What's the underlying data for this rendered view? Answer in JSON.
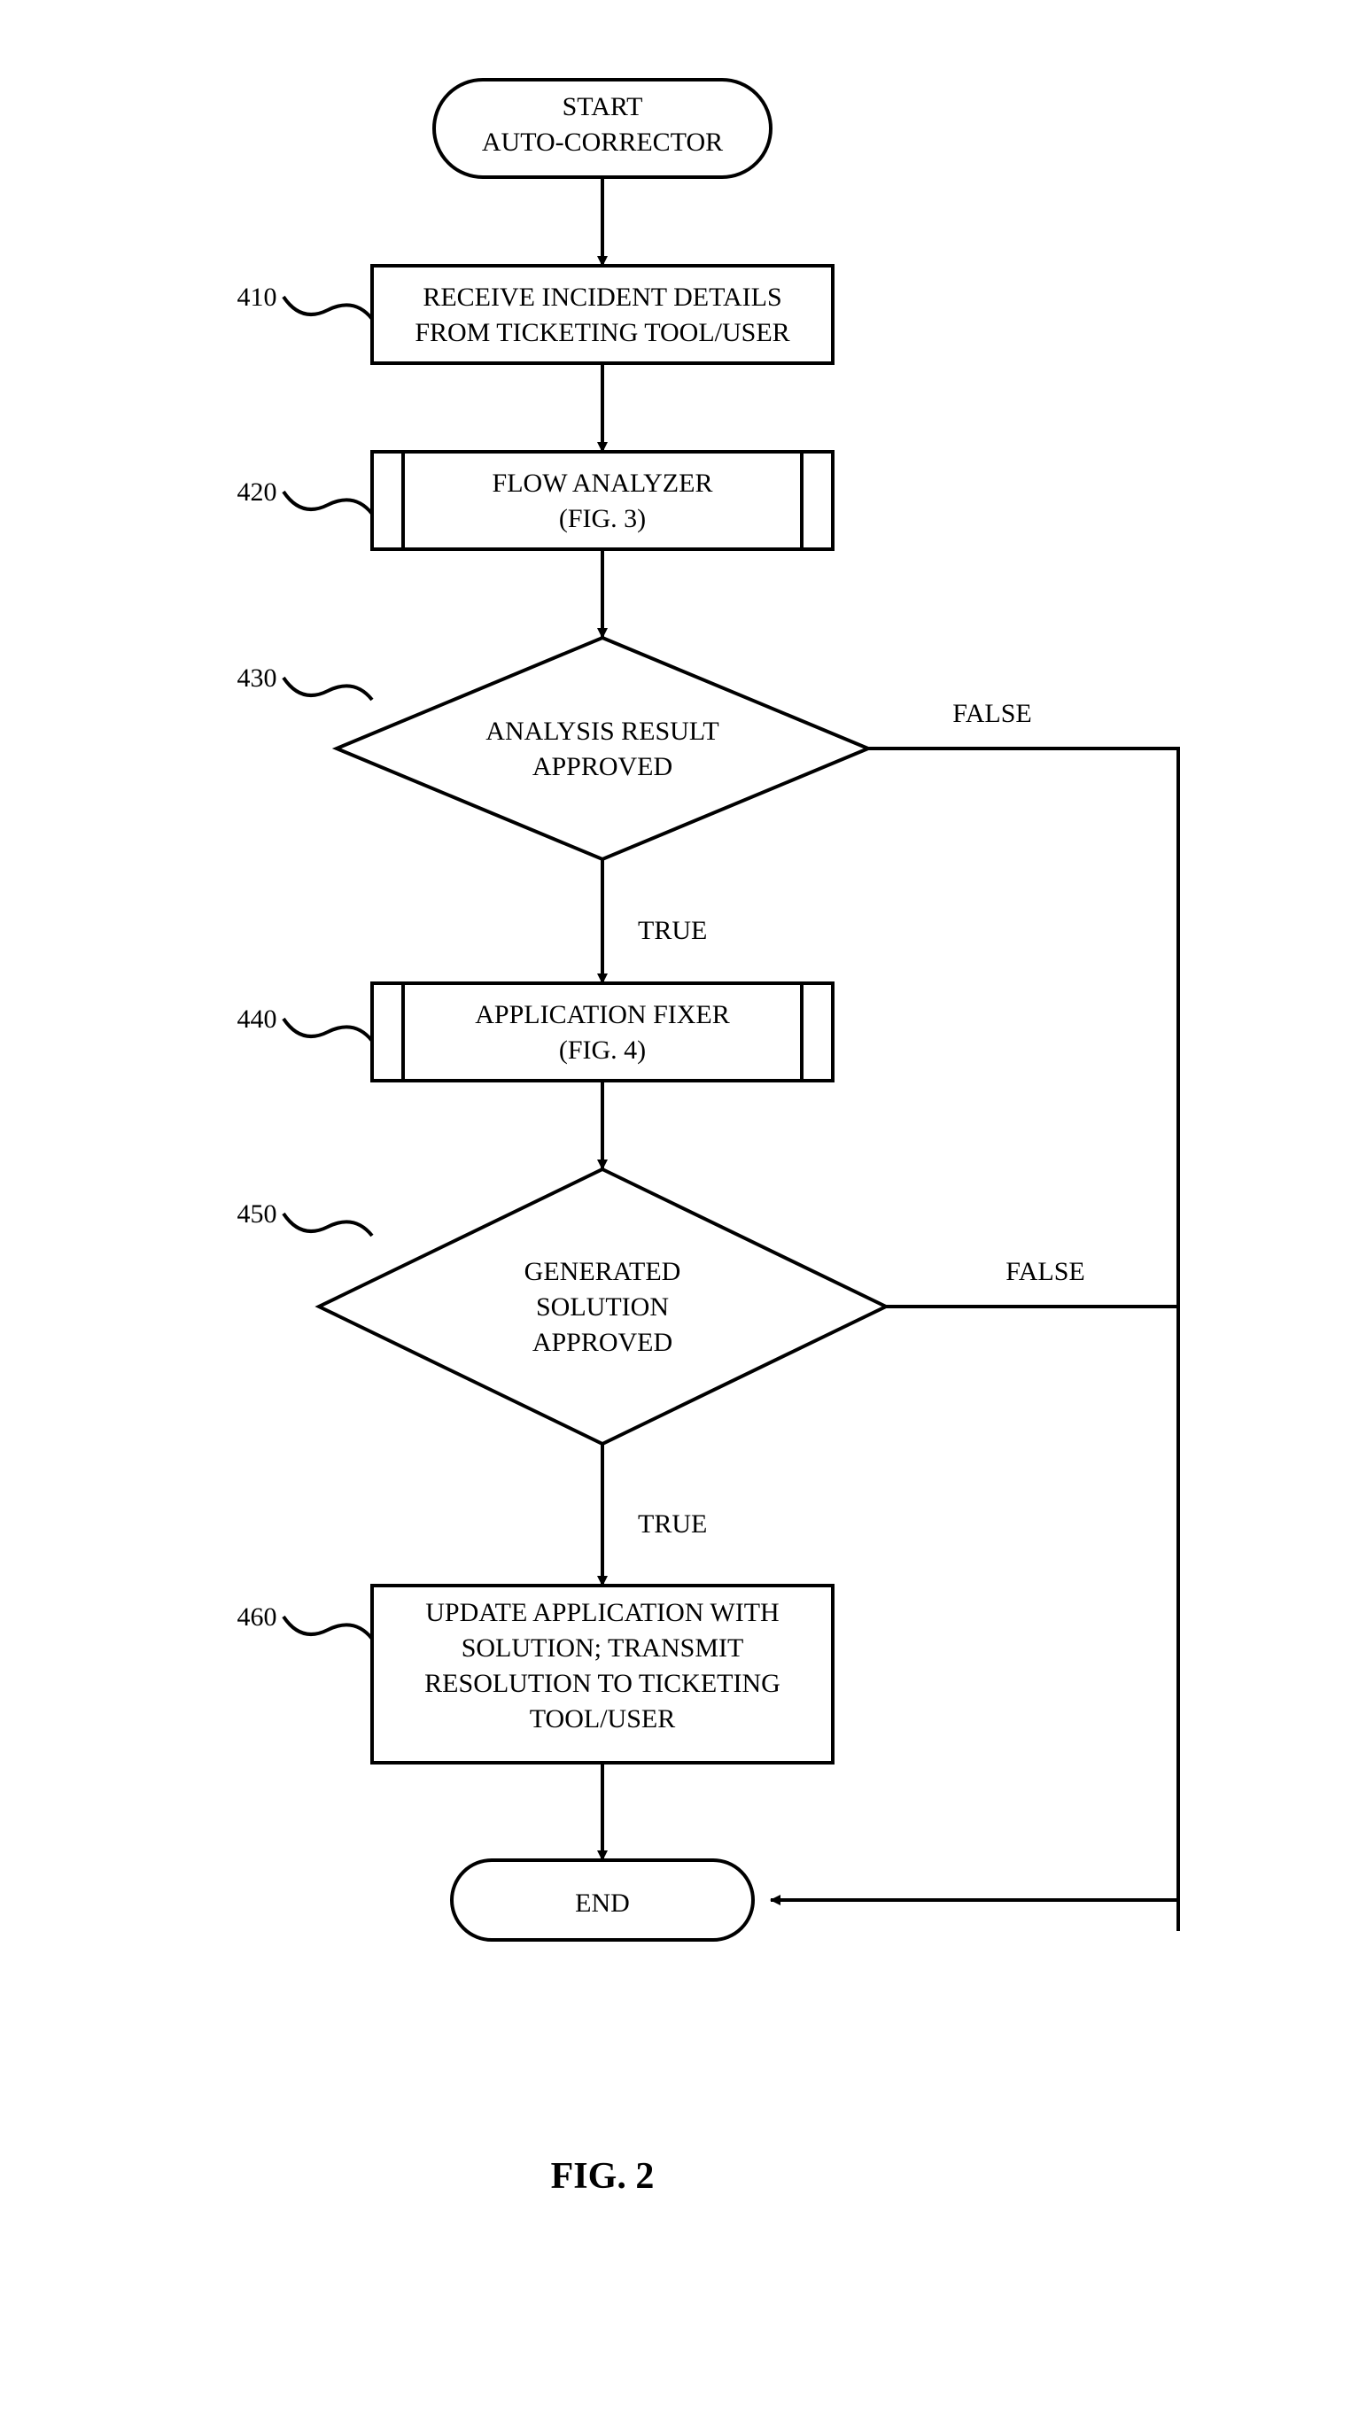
{
  "figure": "FIG. 2",
  "start": {
    "line1": "START",
    "line2": "AUTO-CORRECTOR"
  },
  "n410": {
    "ref": "410",
    "line1": "RECEIVE INCIDENT DETAILS",
    "line2": "FROM TICKETING TOOL/USER"
  },
  "n420": {
    "ref": "420",
    "line1": "FLOW ANALYZER",
    "line2": "(FIG. 3)"
  },
  "n430": {
    "ref": "430",
    "line1": "ANALYSIS RESULT",
    "line2": "APPROVED",
    "true": "TRUE",
    "false": "FALSE"
  },
  "n440": {
    "ref": "440",
    "line1": "APPLICATION FIXER",
    "line2": "(FIG. 4)"
  },
  "n450": {
    "ref": "450",
    "line1": "GENERATED",
    "line2": "SOLUTION",
    "line3": "APPROVED",
    "true": "TRUE",
    "false": "FALSE"
  },
  "n460": {
    "ref": "460",
    "line1": "UPDATE APPLICATION WITH",
    "line2": "SOLUTION; TRANSMIT",
    "line3": "RESOLUTION TO TICKETING",
    "line4": "TOOL/USER"
  },
  "end": {
    "label": "END"
  }
}
